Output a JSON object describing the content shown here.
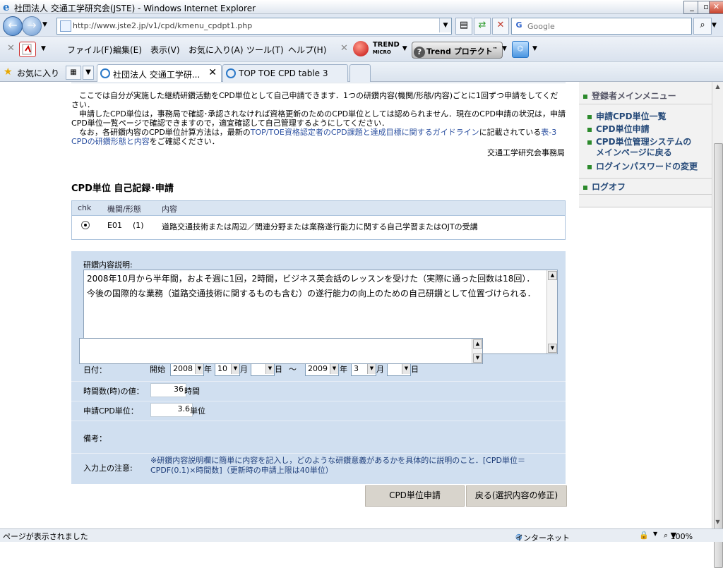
{
  "window": {
    "title": "社団法人 交通工学研究会(JSTE) - Windows Internet Explorer"
  },
  "address": {
    "url": "http://www.jste2.jp/v1/cpd/kmenu_cpdpt1.php",
    "search_placeholder": "Google"
  },
  "menu": {
    "items": [
      "ファイル(F)",
      "編集(E)",
      "表示(V)",
      "お気に入り(A)",
      "ツール(T)",
      "ヘルプ(H)"
    ],
    "trend_logo": "TREND",
    "trend_logo_sub": "MICRO",
    "trend_protect": "Trend プロテクト"
  },
  "favorites": {
    "label": "お気に入り",
    "tabs": [
      "社団法人 交通工学研...",
      "TOP TOE CPD table 3"
    ]
  },
  "intro": {
    "para1": "ここでは自分が実施した継続研鑽活動をCPD単位として自己申請できます．1つの研鑽内容(機関/形態/内容)ごとに1回ずつ申請をしてください．",
    "para2": "申請したCPD単位は，事務局で確認･承認されなければ資格更新のためのCPD単位としては認められません．現在のCPD申請の状況は，申請CPD単位一覧ページで確認できますので，適宜確認して自己管理するようにしてください．",
    "para3_pre": "なお，各研鑽内容のCPD単位計算方法は，最新の",
    "para3_link1": "TOP/TOE資格認定者のCPD課題と達成目標に関するガイドライン",
    "para3_mid": "に記載されている",
    "para3_link2": "表-3 CPDの研鑽形態と内容",
    "para3_post": "をご確認ください．",
    "signature": "交通工学研究会事務局"
  },
  "section": {
    "title": "CPD単位 自己記録･申請"
  },
  "selection_table": {
    "headers": [
      "chk",
      "機関/形態",
      "内容"
    ],
    "row": {
      "code": "E01",
      "form": "(1)",
      "content": "道路交通技術または周辺／関連分野または業務遂行能力に関する自己学習またはOJTの受講"
    }
  },
  "form": {
    "desc_label": "研鑽内容説明:",
    "desc_text": "2008年10月から半年間，およそ週に1回，2時間，ビジネス英会話のレッスンを受けた（実際に通った回数は18回）．今後の国際的な業務（道路交通技術に関するものも含む）の遂行能力の向上のための自己研鑽として位置づけられる．",
    "date_label": "日付：",
    "start_label": "開始",
    "start_year": "2008",
    "start_month": "10",
    "start_day": "",
    "end_year": "2009",
    "end_month": "3",
    "end_day": "",
    "year_unit": "年",
    "month_unit": "月",
    "day_unit": "日",
    "tilde": "～",
    "hours_label": "時間数(時)の値：",
    "hours_value": "36",
    "hours_unit": "時間",
    "units_label": "申請CPD単位：",
    "units_value": "3.6",
    "units_unit": "単位",
    "remarks_label": "備考：",
    "remarks_value": "",
    "note_label": "入力上の注意:",
    "note_text_line1": "※研鑽内容説明欄に簡単に内容を記入し，どのような研鑽意義があるかを具体的に説明のこと．[CPD単位＝",
    "note_text_line2": "CPDF(0.1)×時間数]（更新時の申請上限は40単位）"
  },
  "buttons": {
    "submit": "CPD単位申請",
    "back": "戻る(選択内容の修正)"
  },
  "sidebar": {
    "header": "登録者メインメニュー",
    "items": [
      "申請CPD単位一覧",
      "CPD単位申請",
      "CPD単位管理システムの",
      "メインページに戻る",
      "ログインパスワードの変更"
    ],
    "logoff": "ログオフ"
  },
  "status": {
    "message": "ページが表示されました",
    "zone": "インターネット",
    "zoom": "100%"
  },
  "colors": {
    "form_bg": "#d0dff0",
    "sidebar_square": "#2c8a2c",
    "link": "#2a4fa0"
  }
}
